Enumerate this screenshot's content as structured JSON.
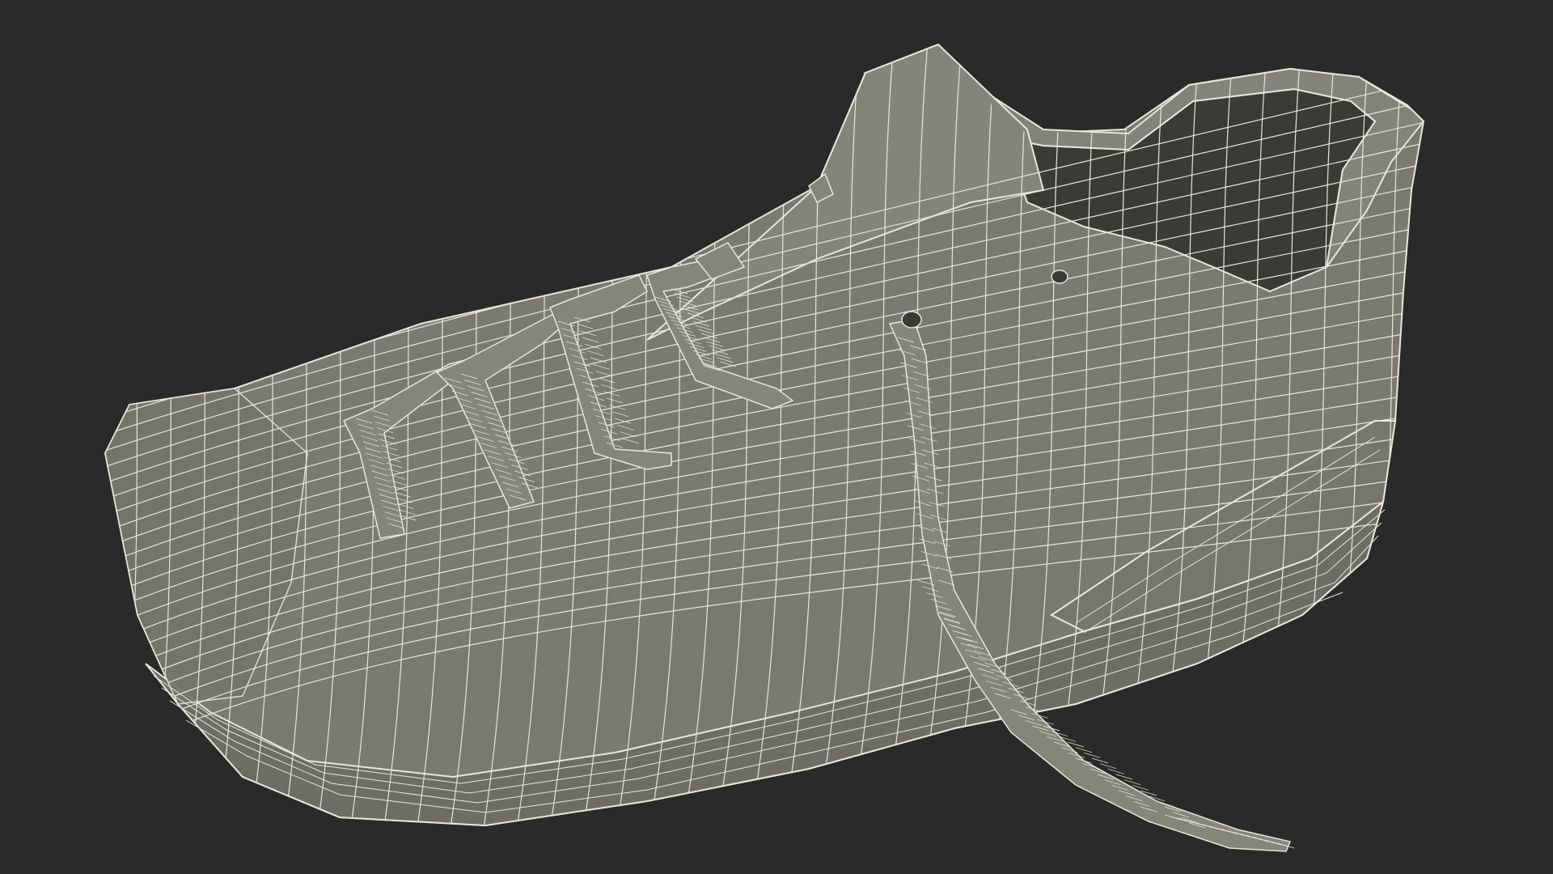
{
  "scene": {
    "background_color": "#2a2a2a",
    "model_fill_color": "#7a7a72",
    "model_shade_color": "#676760",
    "model_dark_color": "#3a3b36",
    "wire_color": "#e6e6da",
    "object": "shoe-wireframe-render"
  }
}
